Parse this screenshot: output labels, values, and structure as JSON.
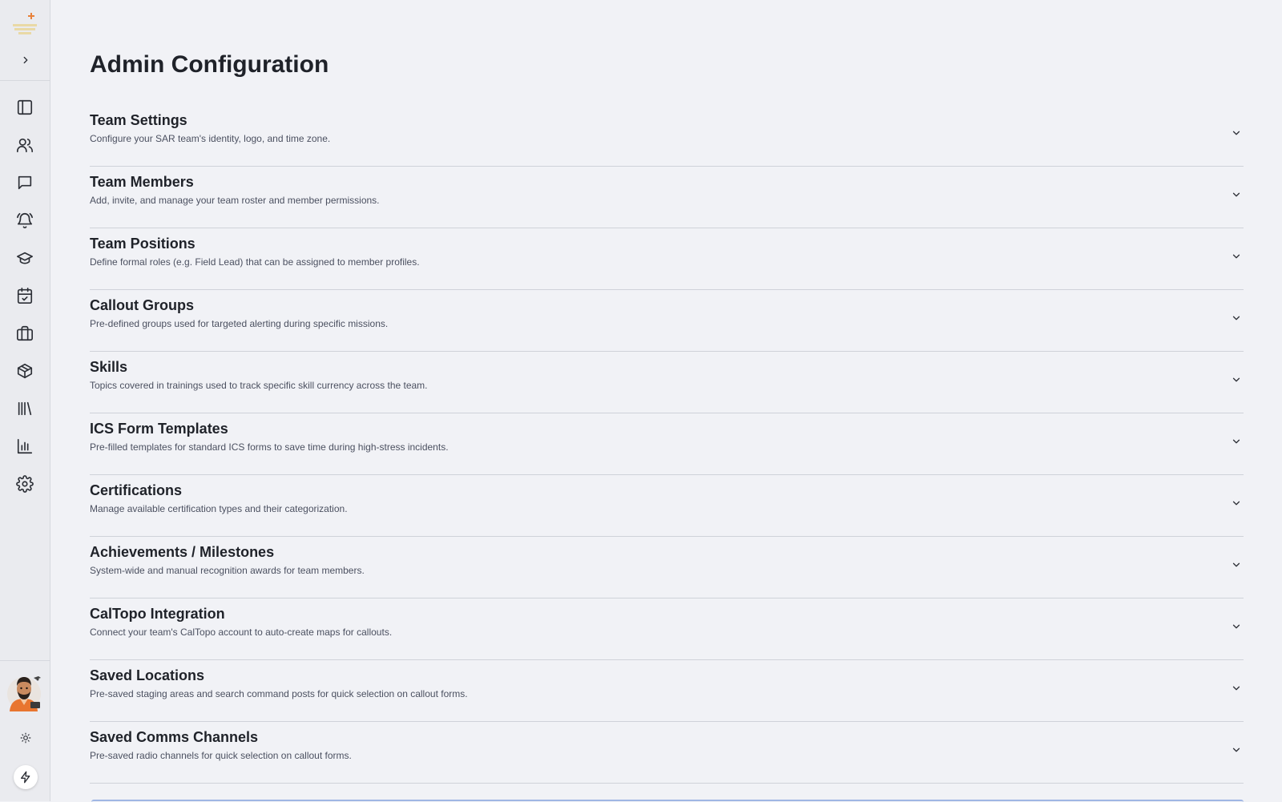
{
  "page": {
    "title": "Admin Configuration"
  },
  "sidebar": {
    "items": [
      {
        "icon": "panel-icon",
        "label": "dashboard"
      },
      {
        "icon": "users-icon",
        "label": "members"
      },
      {
        "icon": "message-icon",
        "label": "messages"
      },
      {
        "icon": "bell-icon",
        "label": "callouts"
      },
      {
        "icon": "graduation-cap-icon",
        "label": "training"
      },
      {
        "icon": "calendar-check-icon",
        "label": "calendar"
      },
      {
        "icon": "briefcase-icon",
        "label": "missions"
      },
      {
        "icon": "package-icon",
        "label": "inventory"
      },
      {
        "icon": "library-icon",
        "label": "library"
      },
      {
        "icon": "bar-chart-icon",
        "label": "reports"
      },
      {
        "icon": "gear-icon",
        "label": "settings"
      }
    ]
  },
  "sections": [
    {
      "title": "Team Settings",
      "description": "Configure your SAR team's identity, logo, and time zone."
    },
    {
      "title": "Team Members",
      "description": "Add, invite, and manage your team roster and member permissions."
    },
    {
      "title": "Team Positions",
      "description": "Define formal roles (e.g. Field Lead) that can be assigned to member profiles."
    },
    {
      "title": "Callout Groups",
      "description": "Pre-defined groups used for targeted alerting during specific missions."
    },
    {
      "title": "Skills",
      "description": "Topics covered in trainings used to track specific skill currency across the team."
    },
    {
      "title": "ICS Form Templates",
      "description": "Pre-filled templates for standard ICS forms to save time during high-stress incidents."
    },
    {
      "title": "Certifications",
      "description": "Manage available certification types and their categorization."
    },
    {
      "title": "Achievements / Milestones",
      "description": "System-wide and manual recognition awards for team members."
    },
    {
      "title": "CalTopo Integration",
      "description": "Connect your team's CalTopo account to auto-create maps for callouts."
    },
    {
      "title": "Saved Locations",
      "description": "Pre-saved staging areas and search command posts for quick selection on callout forms."
    },
    {
      "title": "Saved Comms Channels",
      "description": "Pre-saved radio channels for quick selection on callout forms."
    }
  ],
  "colors": {
    "background": "#f1f2f6",
    "sidebar": "#eaebef",
    "divider": "#cfd2d9",
    "accent_bar": "#9fb6e4",
    "logo_cross": "#e8823a"
  }
}
